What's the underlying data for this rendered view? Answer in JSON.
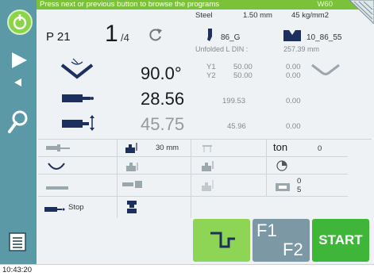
{
  "message": {
    "text": "Press next or previous button to browse the programs",
    "code": "W60"
  },
  "material": {
    "name": "Steel",
    "thickness": "1.50 mm",
    "strength": "45 kg/mm2"
  },
  "program": {
    "label": "P 21",
    "step": "1",
    "step_total": "/4"
  },
  "tool": {
    "punch": "86_G",
    "die": "10_86_55"
  },
  "unfolded": {
    "label": "Unfolded  L  DIN :",
    "value": "257.39 mm"
  },
  "bend": {
    "angle": "90.0°",
    "y1_label": "Y1",
    "y1": "50.00",
    "y2_label": "Y2",
    "y2": "50.00",
    "corr1": "0.00",
    "corr2": "0.00"
  },
  "backgauge": {
    "x": "28.56",
    "x_ref": "199.53",
    "x_corr": "0.00",
    "r": "45.75",
    "r_ref": "45.96",
    "r_corr": "0.00"
  },
  "params": {
    "gap": "30 mm",
    "ton_label": "ton",
    "ton": "0",
    "count_a": "0",
    "count_b": "5",
    "stop": "Stop"
  },
  "buttons": {
    "f1": "F1",
    "f2": "F2",
    "start": "START"
  },
  "clock": "10:43:20",
  "colors": {
    "sidebar": "#5b99a6",
    "green": "#7bc23a",
    "start": "#3fb53a",
    "fkeys": "#7c98a4"
  }
}
